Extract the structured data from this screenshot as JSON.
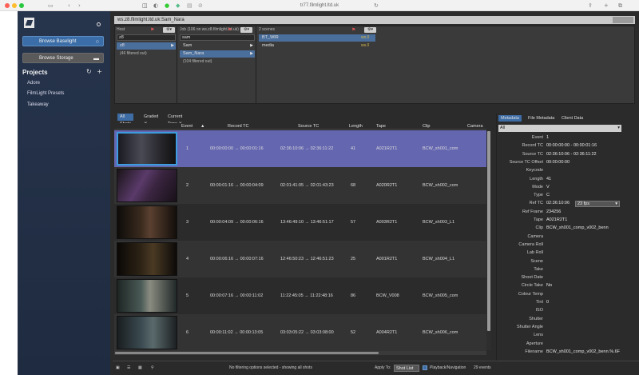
{
  "browser": {
    "url": "tr77.filmlight.ltd.uk"
  },
  "sidebar": {
    "browse_baselight": "Browse Baselight",
    "browse_storage": "Browse Storage",
    "projects_title": "Projects",
    "projects": [
      "Adore",
      "FilmLight Presets",
      "Takeaway"
    ]
  },
  "pathbar": {
    "path": "ws.z8.filmlight.ltd.uk:Sam_Nara"
  },
  "browser_cols": {
    "host": {
      "label": "Host",
      "search": "z8",
      "item": "z8",
      "note": "(46 filtered out)"
    },
    "job": {
      "label": "Job (106 on ws.z8.filmlight.ltd.uk)",
      "search": "sam",
      "items": [
        "Sam",
        "Sam_Nara"
      ],
      "note": "(104 filtered out)"
    },
    "scenes": {
      "label": "2 scenes",
      "items": [
        {
          "name": "BT_WIR",
          "fps": "ws.0"
        },
        {
          "name": "media",
          "fps": "ws.0"
        }
      ]
    }
  },
  "tabs": [
    "All Shots",
    "Graded",
    "Current Tape"
  ],
  "headers": {
    "event": "Event",
    "record": "Record TC",
    "source": "Source TC",
    "length": "Length",
    "tape": "Tape",
    "clip": "Clip",
    "camera": "Camera"
  },
  "rows": [
    {
      "event": "1",
      "record": "00:00:00:00 → 00:00:01:16",
      "source": "02:36:10:06 → 02:36:11:22",
      "length": "41",
      "tape": "A021R2T1",
      "clip": "BCW_sh001_com"
    },
    {
      "event": "2",
      "record": "00:00:01:16 → 00:00:04:09",
      "source": "02:01:41:05 → 02:01:43:23",
      "length": "68",
      "tape": "A020R2T1",
      "clip": "BCW_sh002_com"
    },
    {
      "event": "3",
      "record": "00:00:04:09 → 00:00:06:16",
      "source": "13:46:49:10 → 13:46:51:17",
      "length": "57",
      "tape": "A003R2T1",
      "clip": "BCW_sh003_L1"
    },
    {
      "event": "4",
      "record": "00:00:06:16 → 00:00:07:16",
      "source": "12:46:50:23 → 12:46:51:23",
      "length": "25",
      "tape": "A001R2T1",
      "clip": "BCW_sh004_L1"
    },
    {
      "event": "5",
      "record": "00:00:07:16 → 00:00:11:02",
      "source": "11:22:45:05 → 11:22:48:16",
      "length": "86",
      "tape": "BCW_V008",
      "clip": "BCW_sh005_com"
    },
    {
      "event": "6",
      "record": "00:00:11:02 → 00:00:13:05",
      "source": "03:03:05:22 → 03:03:08:00",
      "length": "52",
      "tape": "A004R2T1",
      "clip": "BCW_sh006_com"
    }
  ],
  "bottombar": {
    "status": "No filtering options selected - showing all shots",
    "apply_to": "Apply To:",
    "apply_value": "Shot List",
    "playback": "Playback/Navigation",
    "events": "29 events"
  },
  "meta": {
    "tabs": [
      "Metadata",
      "File Metadata",
      "Client Data"
    ],
    "filter": "All",
    "fps_value": "23 fps",
    "fields": [
      {
        "label": "Event",
        "value": "1"
      },
      {
        "label": "Record TC",
        "value": "00:00:00:00 - 00:00:01:16"
      },
      {
        "label": "Source TC",
        "value": "02:36:10:06 - 02:36:11:22"
      },
      {
        "label": "Source TC Offset",
        "value": "00:00:00:00"
      },
      {
        "label": "Keycode",
        "value": ""
      },
      {
        "label": "Length",
        "value": "41"
      },
      {
        "label": "Mode",
        "value": "V"
      },
      {
        "label": "Type",
        "value": "C"
      },
      {
        "label": "Ref TC",
        "value": "02:36:10:06"
      },
      {
        "label": "Ref Frame",
        "value": "234256"
      },
      {
        "label": "Tape",
        "value": "A021R2T1"
      },
      {
        "label": "Clip",
        "value": "BCW_sh001_comp_v002_benn"
      },
      {
        "label": "Camera",
        "value": ""
      },
      {
        "label": "Camera Roll",
        "value": ""
      },
      {
        "label": "Lab Roll",
        "value": ""
      },
      {
        "label": "Scene",
        "value": ""
      },
      {
        "label": "Take",
        "value": ""
      },
      {
        "label": "Shoot Date",
        "value": ""
      },
      {
        "label": "Circle Take",
        "value": "No"
      },
      {
        "label": "Colour Temp",
        "value": ""
      },
      {
        "label": "Tint",
        "value": "0"
      },
      {
        "label": "ISO",
        "value": ""
      },
      {
        "label": "Shutter",
        "value": ""
      },
      {
        "label": "Shutter Angle",
        "value": ""
      },
      {
        "label": "Lens",
        "value": ""
      },
      {
        "label": "Aperture",
        "value": ""
      },
      {
        "label": "Filename",
        "value": "BCW_sh001_comp_v002_benn.%.6F"
      }
    ]
  },
  "colors": {
    "sidebar": "#26344c",
    "accent": "#3e6da6",
    "selected_row": "#6466b0"
  }
}
